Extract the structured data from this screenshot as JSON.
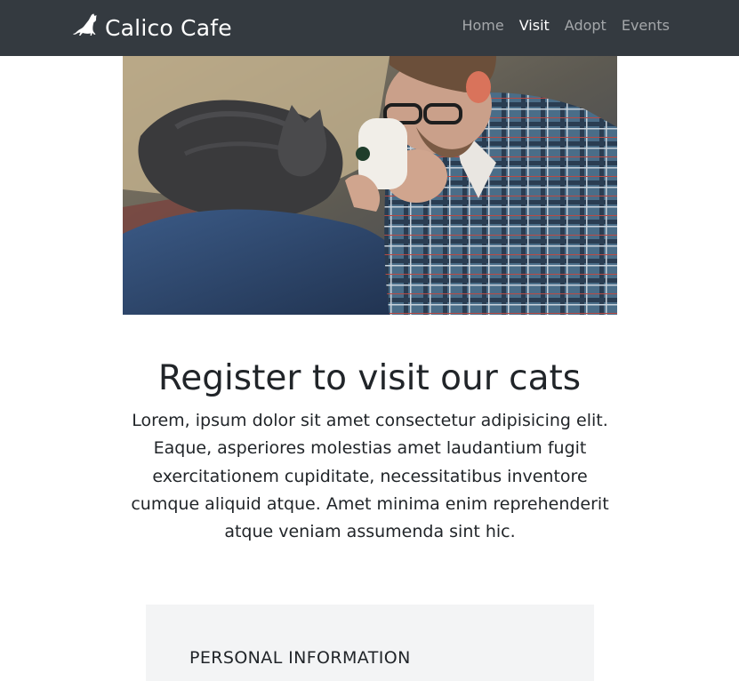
{
  "navbar": {
    "brand_icon": "cat-icon",
    "brand_name": "Calico Cafe",
    "links": [
      {
        "label": "Home",
        "active": false
      },
      {
        "label": "Visit",
        "active": true
      },
      {
        "label": "Adopt",
        "active": false
      },
      {
        "label": "Events",
        "active": false
      }
    ],
    "background": "#343a40"
  },
  "hero": {
    "image": "photo-man-drinking-coffee-with-cat"
  },
  "intro": {
    "title": "Register to visit our cats",
    "text": "Lorem, ipsum dolor sit amet consectetur adipisicing elit. Eaque, asperiores molestias amet laudantium fugit exercitationem cupiditate, necessitatibus inventore cumque aliquid atque. Amet minima enim reprehenderit atque veniam assumenda sint hic."
  },
  "form": {
    "section_heading": "PERSONAL INFORMATION",
    "background": "#f3f4f5"
  }
}
